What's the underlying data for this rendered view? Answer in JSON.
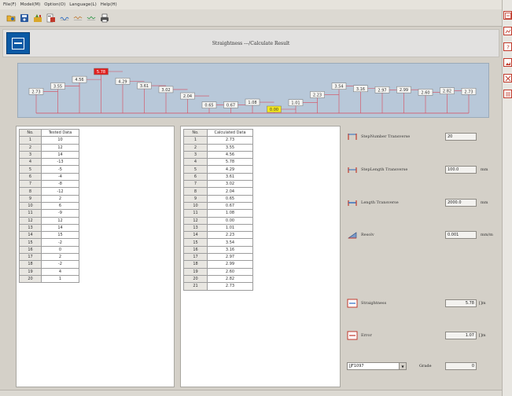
{
  "menu": [
    "File(F)",
    "Model(M)",
    "Option(O)",
    "Language(L)",
    "Help(H)"
  ],
  "toolbar": {
    "icons": [
      "open-folder-icon",
      "save-icon",
      "tools-icon",
      "report-icon",
      "wave-icon",
      "wave-icon",
      "wave-icon",
      "print-icon"
    ]
  },
  "title": {
    "text": "Straightness ---/Calculate Result"
  },
  "profile": {
    "values": [
      "2.73",
      "3.55",
      "4.56",
      "5.78",
      "4.29",
      "3.61",
      "3.02",
      "2.04",
      "0.65",
      "0.67",
      "1.08",
      "0.00",
      "1.01",
      "2.23",
      "3.54",
      "3.16",
      "2.97",
      "2.99",
      "2.60",
      "2.82",
      "2.73"
    ],
    "max_color": "#e0201f",
    "min_color": "#f5e81c"
  },
  "tested": {
    "header_no": "No.",
    "header_val": "Tested Data",
    "rows": [
      {
        "no": "1",
        "val": "10"
      },
      {
        "no": "2",
        "val": "12"
      },
      {
        "no": "3",
        "val": "14"
      },
      {
        "no": "4",
        "val": "-13"
      },
      {
        "no": "5",
        "val": "-5"
      },
      {
        "no": "6",
        "val": "-4"
      },
      {
        "no": "7",
        "val": "-8"
      },
      {
        "no": "8",
        "val": "-12"
      },
      {
        "no": "9",
        "val": "2"
      },
      {
        "no": "10",
        "val": "6"
      },
      {
        "no": "11",
        "val": "-9"
      },
      {
        "no": "12",
        "val": "12"
      },
      {
        "no": "13",
        "val": "14"
      },
      {
        "no": "14",
        "val": "15"
      },
      {
        "no": "15",
        "val": "-2"
      },
      {
        "no": "16",
        "val": "0"
      },
      {
        "no": "17",
        "val": "2"
      },
      {
        "no": "18",
        "val": "-2"
      },
      {
        "no": "19",
        "val": "4"
      },
      {
        "no": "20",
        "val": "1"
      }
    ]
  },
  "calculated": {
    "header_no": "No.",
    "header_val": "Calculated Data",
    "rows": [
      {
        "no": "1",
        "val": "2.73"
      },
      {
        "no": "2",
        "val": "3.55"
      },
      {
        "no": "3",
        "val": "4.56"
      },
      {
        "no": "4",
        "val": "5.78"
      },
      {
        "no": "5",
        "val": "4.29"
      },
      {
        "no": "6",
        "val": "3.61"
      },
      {
        "no": "7",
        "val": "3.02"
      },
      {
        "no": "8",
        "val": "2.04"
      },
      {
        "no": "9",
        "val": "0.65"
      },
      {
        "no": "10",
        "val": "0.67"
      },
      {
        "no": "11",
        "val": "1.08"
      },
      {
        "no": "12",
        "val": "0.00"
      },
      {
        "no": "13",
        "val": "1.01"
      },
      {
        "no": "14",
        "val": "2.23"
      },
      {
        "no": "15",
        "val": "3.54"
      },
      {
        "no": "16",
        "val": "3.16"
      },
      {
        "no": "17",
        "val": "2.97"
      },
      {
        "no": "18",
        "val": "2.99"
      },
      {
        "no": "19",
        "val": "2.60"
      },
      {
        "no": "20",
        "val": "2.82"
      },
      {
        "no": "21",
        "val": "2.73"
      }
    ]
  },
  "params": {
    "step_number": {
      "label": "StepNumber Transverse",
      "value": "20",
      "unit": ""
    },
    "step_length": {
      "label": "StepLength Transverse",
      "value": "100.0",
      "unit": "mm"
    },
    "length": {
      "label": "Length Transverse",
      "value": "2000.0",
      "unit": "mm"
    },
    "resolv": {
      "label": "Resolv",
      "value": "0.001",
      "unit": "mm/m"
    },
    "straightness": {
      "label": "Straightness",
      "value": "5.78",
      "unit": "[]m"
    },
    "error": {
      "label": "Error",
      "value": "1.07",
      "unit": "[]m"
    }
  },
  "standard": {
    "value": "JJF1097"
  },
  "grade": {
    "label": "Grade",
    "value": "0"
  },
  "colors": {
    "accent": "#0a5aa5",
    "icon_red": "#c0392b",
    "profile_bg": "#b8c8d9"
  }
}
